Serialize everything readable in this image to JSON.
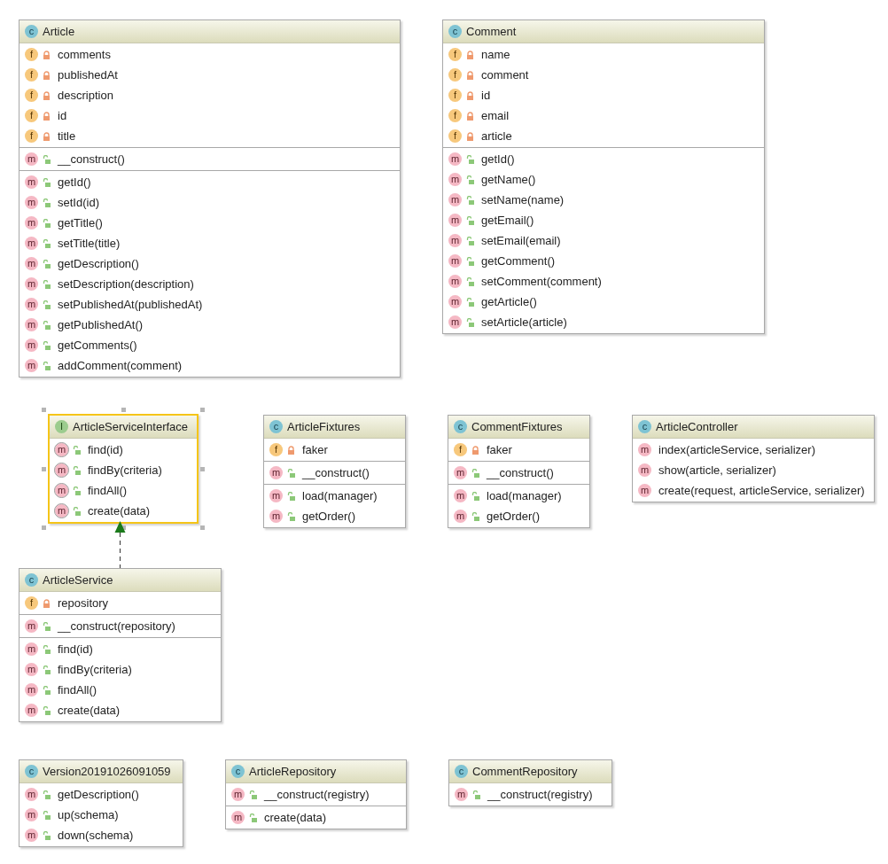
{
  "nodes": [
    {
      "kind": "class",
      "badge": "c",
      "name": "Article",
      "selected": false,
      "sections": [
        [
          {
            "kind": "field",
            "badge": "f",
            "private": true,
            "text": "comments"
          },
          {
            "kind": "field",
            "badge": "f",
            "private": true,
            "text": "publishedAt"
          },
          {
            "kind": "field",
            "badge": "f",
            "private": true,
            "text": "description"
          },
          {
            "kind": "field",
            "badge": "f",
            "private": true,
            "text": "id"
          },
          {
            "kind": "field",
            "badge": "f",
            "private": true,
            "text": "title"
          }
        ],
        [
          {
            "kind": "method",
            "badge": "m",
            "private": false,
            "text": "__construct()"
          }
        ],
        [
          {
            "kind": "method",
            "badge": "m",
            "private": false,
            "text": "getId()"
          },
          {
            "kind": "method",
            "badge": "m",
            "private": false,
            "text": "setId(id)"
          },
          {
            "kind": "method",
            "badge": "m",
            "private": false,
            "text": "getTitle()"
          },
          {
            "kind": "method",
            "badge": "m",
            "private": false,
            "text": "setTitle(title)"
          },
          {
            "kind": "method",
            "badge": "m",
            "private": false,
            "text": "getDescription()"
          },
          {
            "kind": "method",
            "badge": "m",
            "private": false,
            "text": "setDescription(description)"
          },
          {
            "kind": "method",
            "badge": "m",
            "private": false,
            "text": "setPublishedAt(publishedAt)"
          },
          {
            "kind": "method",
            "badge": "m",
            "private": false,
            "text": "getPublishedAt()"
          },
          {
            "kind": "method",
            "badge": "m",
            "private": false,
            "text": "getComments()"
          },
          {
            "kind": "method",
            "badge": "m",
            "private": false,
            "text": "addComment(comment)"
          }
        ]
      ]
    },
    {
      "kind": "class",
      "badge": "c",
      "name": "Comment",
      "selected": false,
      "sections": [
        [
          {
            "kind": "field",
            "badge": "f",
            "private": true,
            "text": "name"
          },
          {
            "kind": "field",
            "badge": "f",
            "private": true,
            "text": "comment"
          },
          {
            "kind": "field",
            "badge": "f",
            "private": true,
            "text": "id"
          },
          {
            "kind": "field",
            "badge": "f",
            "private": true,
            "text": "email"
          },
          {
            "kind": "field",
            "badge": "f",
            "private": true,
            "text": "article"
          }
        ],
        [
          {
            "kind": "method",
            "badge": "m",
            "private": false,
            "text": "getId()"
          },
          {
            "kind": "method",
            "badge": "m",
            "private": false,
            "text": "getName()"
          },
          {
            "kind": "method",
            "badge": "m",
            "private": false,
            "text": "setName(name)"
          },
          {
            "kind": "method",
            "badge": "m",
            "private": false,
            "text": "getEmail()"
          },
          {
            "kind": "method",
            "badge": "m",
            "private": false,
            "text": "setEmail(email)"
          },
          {
            "kind": "method",
            "badge": "m",
            "private": false,
            "text": "getComment()"
          },
          {
            "kind": "method",
            "badge": "m",
            "private": false,
            "text": "setComment(comment)"
          },
          {
            "kind": "method",
            "badge": "m",
            "private": false,
            "text": "getArticle()"
          },
          {
            "kind": "method",
            "badge": "m",
            "private": false,
            "text": "setArticle(article)"
          }
        ]
      ]
    },
    {
      "kind": "interface",
      "badge": "I",
      "name": "ArticleServiceInterface",
      "selected": true,
      "sections": [
        [
          {
            "kind": "method",
            "badge": "m",
            "abstract": true,
            "private": false,
            "text": "find(id)"
          },
          {
            "kind": "method",
            "badge": "m",
            "abstract": true,
            "private": false,
            "text": "findBy(criteria)"
          },
          {
            "kind": "method",
            "badge": "m",
            "abstract": true,
            "private": false,
            "text": "findAll()"
          },
          {
            "kind": "method",
            "badge": "m",
            "abstract": true,
            "private": false,
            "text": "create(data)"
          }
        ]
      ]
    },
    {
      "kind": "class",
      "badge": "c",
      "name": "ArticleFixtures",
      "selected": false,
      "sections": [
        [
          {
            "kind": "field",
            "badge": "f",
            "private": true,
            "text": "faker"
          }
        ],
        [
          {
            "kind": "method",
            "badge": "m",
            "private": false,
            "text": "__construct()"
          }
        ],
        [
          {
            "kind": "method",
            "badge": "m",
            "private": false,
            "text": "load(manager)"
          },
          {
            "kind": "method",
            "badge": "m",
            "private": false,
            "text": "getOrder()"
          }
        ]
      ]
    },
    {
      "kind": "class",
      "badge": "c",
      "name": "CommentFixtures",
      "selected": false,
      "sections": [
        [
          {
            "kind": "field",
            "badge": "f",
            "private": true,
            "text": "faker"
          }
        ],
        [
          {
            "kind": "method",
            "badge": "m",
            "private": false,
            "text": "__construct()"
          }
        ],
        [
          {
            "kind": "method",
            "badge": "m",
            "private": false,
            "text": "load(manager)"
          },
          {
            "kind": "method",
            "badge": "m",
            "private": false,
            "text": "getOrder()"
          }
        ]
      ]
    },
    {
      "kind": "class",
      "badge": "c",
      "name": "ArticleController",
      "selected": false,
      "sections": [
        [
          {
            "kind": "method",
            "badge": "m",
            "text": "index(articleService, serializer)"
          },
          {
            "kind": "method",
            "badge": "m",
            "text": "show(article, serializer)"
          },
          {
            "kind": "method",
            "badge": "m",
            "text": "create(request, articleService, serializer)"
          }
        ]
      ]
    },
    {
      "kind": "class",
      "badge": "c",
      "name": "ArticleService",
      "selected": false,
      "sections": [
        [
          {
            "kind": "field",
            "badge": "f",
            "private": true,
            "text": "repository"
          }
        ],
        [
          {
            "kind": "method",
            "badge": "m",
            "private": false,
            "text": "__construct(repository)"
          }
        ],
        [
          {
            "kind": "method",
            "badge": "m",
            "private": false,
            "text": "find(id)"
          },
          {
            "kind": "method",
            "badge": "m",
            "private": false,
            "text": "findBy(criteria)"
          },
          {
            "kind": "method",
            "badge": "m",
            "private": false,
            "text": "findAll()"
          },
          {
            "kind": "method",
            "badge": "m",
            "private": false,
            "text": "create(data)"
          }
        ]
      ]
    },
    {
      "kind": "class",
      "badge": "c",
      "name": "Version20191026091059",
      "selected": false,
      "sections": [
        [
          {
            "kind": "method",
            "badge": "m",
            "private": false,
            "text": "getDescription()"
          },
          {
            "kind": "method",
            "badge": "m",
            "private": false,
            "text": "up(schema)"
          },
          {
            "kind": "method",
            "badge": "m",
            "private": false,
            "text": "down(schema)"
          }
        ]
      ]
    },
    {
      "kind": "class",
      "badge": "c",
      "name": "ArticleRepository",
      "selected": false,
      "sections": [
        [
          {
            "kind": "method",
            "badge": "m",
            "private": false,
            "text": "__construct(registry)"
          }
        ],
        [
          {
            "kind": "method",
            "badge": "m",
            "private": false,
            "text": "create(data)"
          }
        ]
      ]
    },
    {
      "kind": "class",
      "badge": "c",
      "name": "CommentRepository",
      "selected": false,
      "sections": [
        [
          {
            "kind": "method",
            "badge": "m",
            "private": false,
            "text": "__construct(registry)"
          }
        ]
      ]
    }
  ],
  "edges": [
    {
      "kind": "realization"
    }
  ]
}
